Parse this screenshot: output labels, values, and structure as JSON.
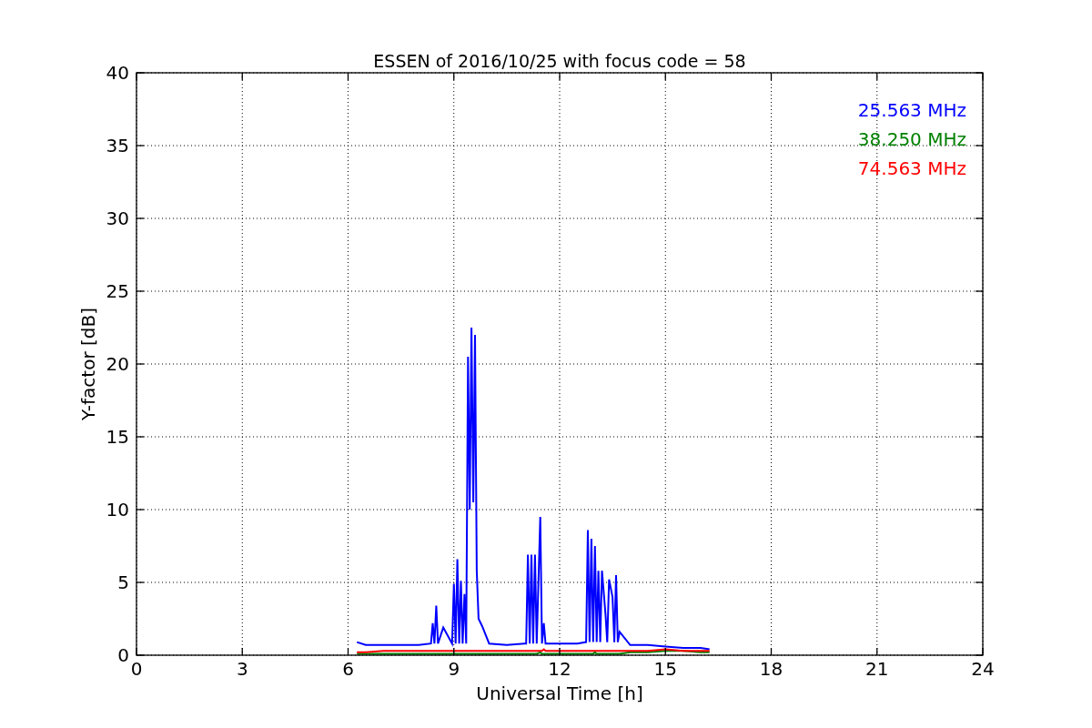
{
  "figure": {
    "chart_data": {
      "type": "line",
      "title": "ESSEN of 2016/10/25 with focus code = 58",
      "xlabel": "Universal Time [h]",
      "ylabel": "Y-factor [dB]",
      "x": [
        6.25,
        6.5,
        7,
        7.5,
        8,
        8.35,
        8.4,
        8.45,
        8.5,
        8.55,
        8.7,
        8.95,
        9.0,
        9.05,
        9.1,
        9.15,
        9.2,
        9.25,
        9.3,
        9.35,
        9.4,
        9.45,
        9.5,
        9.55,
        9.6,
        9.65,
        9.7,
        9.8,
        10,
        10.5,
        11,
        11.05,
        11.1,
        11.15,
        11.2,
        11.25,
        11.3,
        11.35,
        11.45,
        11.5,
        11.55,
        11.6,
        11.7,
        12,
        12.5,
        12.75,
        12.8,
        12.85,
        12.9,
        12.95,
        13.0,
        13.05,
        13.1,
        13.15,
        13.2,
        13.3,
        13.35,
        13.4,
        13.5,
        13.55,
        13.6,
        13.65,
        13.7,
        14,
        14.5,
        15,
        15.5,
        16,
        16.25
      ],
      "series": [
        {
          "name": "25.563 MHz",
          "color": "#0000ff",
          "values": [
            0.9,
            0.7,
            0.7,
            0.7,
            0.7,
            0.8,
            2.2,
            0.8,
            3.4,
            0.8,
            1.9,
            0.8,
            4.9,
            0.8,
            6.6,
            0.8,
            5.1,
            0.8,
            4.2,
            0.8,
            20.5,
            10.0,
            22.5,
            10.5,
            22.0,
            5.8,
            2.5,
            2.0,
            0.8,
            0.7,
            0.8,
            0.8,
            6.9,
            0.8,
            6.9,
            0.8,
            6.9,
            0.8,
            9.5,
            0.8,
            2.2,
            0.8,
            0.8,
            0.8,
            0.8,
            0.9,
            8.6,
            0.9,
            8.0,
            0.9,
            7.5,
            0.9,
            5.8,
            0.9,
            5.8,
            2.8,
            0.9,
            5.2,
            4.0,
            0.9,
            5.5,
            0.9,
            1.6,
            0.7,
            0.7,
            0.6,
            0.5,
            0.5,
            0.4
          ]
        },
        {
          "name": "38.250 MHz",
          "color": "#008000",
          "values": [
            0.1,
            0.1,
            0.1,
            0.1,
            0.1,
            0.1,
            0.1,
            0.1,
            0.1,
            0.1,
            0.1,
            0.1,
            0.1,
            0.1,
            0.1,
            0.1,
            0.1,
            0.1,
            0.1,
            0.1,
            0.1,
            0.1,
            0.1,
            0.1,
            0.1,
            0.1,
            0.1,
            0.1,
            0.1,
            0.1,
            0.1,
            0.1,
            0.1,
            0.1,
            0.1,
            0.1,
            0.1,
            0.1,
            0.2,
            0.1,
            0.1,
            0.1,
            0.1,
            0.1,
            0.1,
            0.1,
            0.1,
            0.1,
            0.1,
            0.1,
            0.2,
            0.1,
            0.1,
            0.1,
            0.1,
            0.1,
            0.1,
            0.1,
            0.1,
            0.1,
            0.1,
            0.1,
            0.1,
            0.2,
            0.2,
            0.3,
            0.3,
            0.2,
            0.2
          ]
        },
        {
          "name": "74.563 MHz",
          "color": "#ff0000",
          "values": [
            0.2,
            0.2,
            0.3,
            0.3,
            0.3,
            0.3,
            0.3,
            0.3,
            0.3,
            0.3,
            0.3,
            0.3,
            0.3,
            0.3,
            0.3,
            0.3,
            0.3,
            0.3,
            0.3,
            0.3,
            0.3,
            0.3,
            0.3,
            0.3,
            0.3,
            0.3,
            0.3,
            0.3,
            0.3,
            0.3,
            0.3,
            0.3,
            0.3,
            0.3,
            0.3,
            0.3,
            0.3,
            0.3,
            0.3,
            0.3,
            0.4,
            0.3,
            0.3,
            0.3,
            0.3,
            0.3,
            0.3,
            0.3,
            0.3,
            0.3,
            0.3,
            0.3,
            0.3,
            0.3,
            0.3,
            0.3,
            0.3,
            0.3,
            0.3,
            0.3,
            0.3,
            0.3,
            0.3,
            0.3,
            0.3,
            0.4,
            0.3,
            0.3,
            0.3
          ]
        }
      ],
      "xlim": [
        0,
        24
      ],
      "ylim": [
        0,
        40
      ],
      "grid": true,
      "xticks": [
        0,
        3,
        6,
        9,
        12,
        15,
        18,
        21,
        24
      ],
      "yticks": [
        0,
        5,
        10,
        15,
        20,
        25,
        30,
        35,
        40
      ]
    }
  }
}
